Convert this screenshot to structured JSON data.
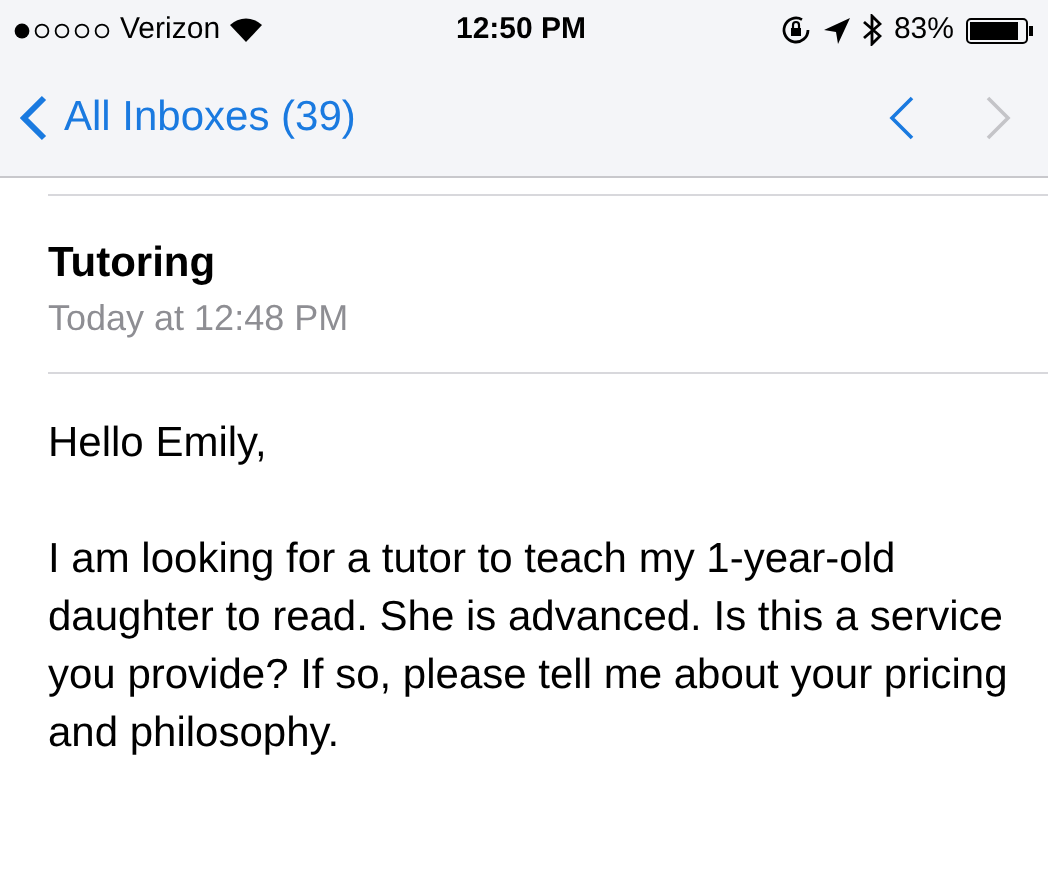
{
  "status_bar": {
    "carrier": "Verizon",
    "time": "12:50 PM",
    "battery": "83%"
  },
  "nav_bar": {
    "back_label": "All Inboxes (39)",
    "previous": {
      "disabled": false
    },
    "next": {
      "disabled": true
    }
  },
  "message": {
    "subject": "Tutoring",
    "date": "Today at 12:48 PM",
    "greeting": "Hello Emily,",
    "body": "I am looking for a tutor to teach my 1-year-old daughter to read. She is advanced. Is this a service you provide? If so, please tell me about your pricing and philosophy."
  }
}
